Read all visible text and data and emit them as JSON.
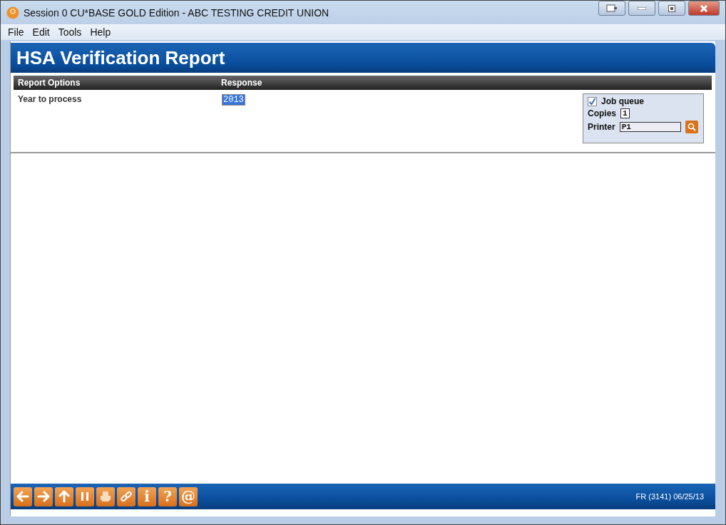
{
  "window": {
    "title": "Session 0 CU*BASE GOLD Edition - ABC TESTING CREDIT UNION"
  },
  "menu": [
    "File",
    "Edit",
    "Tools",
    "Help"
  ],
  "header": {
    "title": "HSA Verification Report"
  },
  "table": {
    "columns": [
      "Report Options",
      "Response"
    ],
    "rows": [
      {
        "label": "Year to process",
        "value": "2013",
        "selected": true
      }
    ]
  },
  "options": {
    "job_queue": {
      "label": "Job queue",
      "checked": true
    },
    "copies": {
      "label": "Copies",
      "value": "1"
    },
    "printer": {
      "label": "Printer",
      "value": "P1"
    }
  },
  "toolbar": [
    {
      "kind": "back"
    },
    {
      "kind": "forward"
    },
    {
      "kind": "up"
    },
    {
      "kind": "pause"
    },
    {
      "kind": "print"
    },
    {
      "kind": "link"
    },
    {
      "kind": "glyph",
      "text": "i"
    },
    {
      "kind": "glyph",
      "text": "?"
    },
    {
      "kind": "glyph",
      "text": "@"
    }
  ],
  "status": "FR (3141) 06/25/13"
}
